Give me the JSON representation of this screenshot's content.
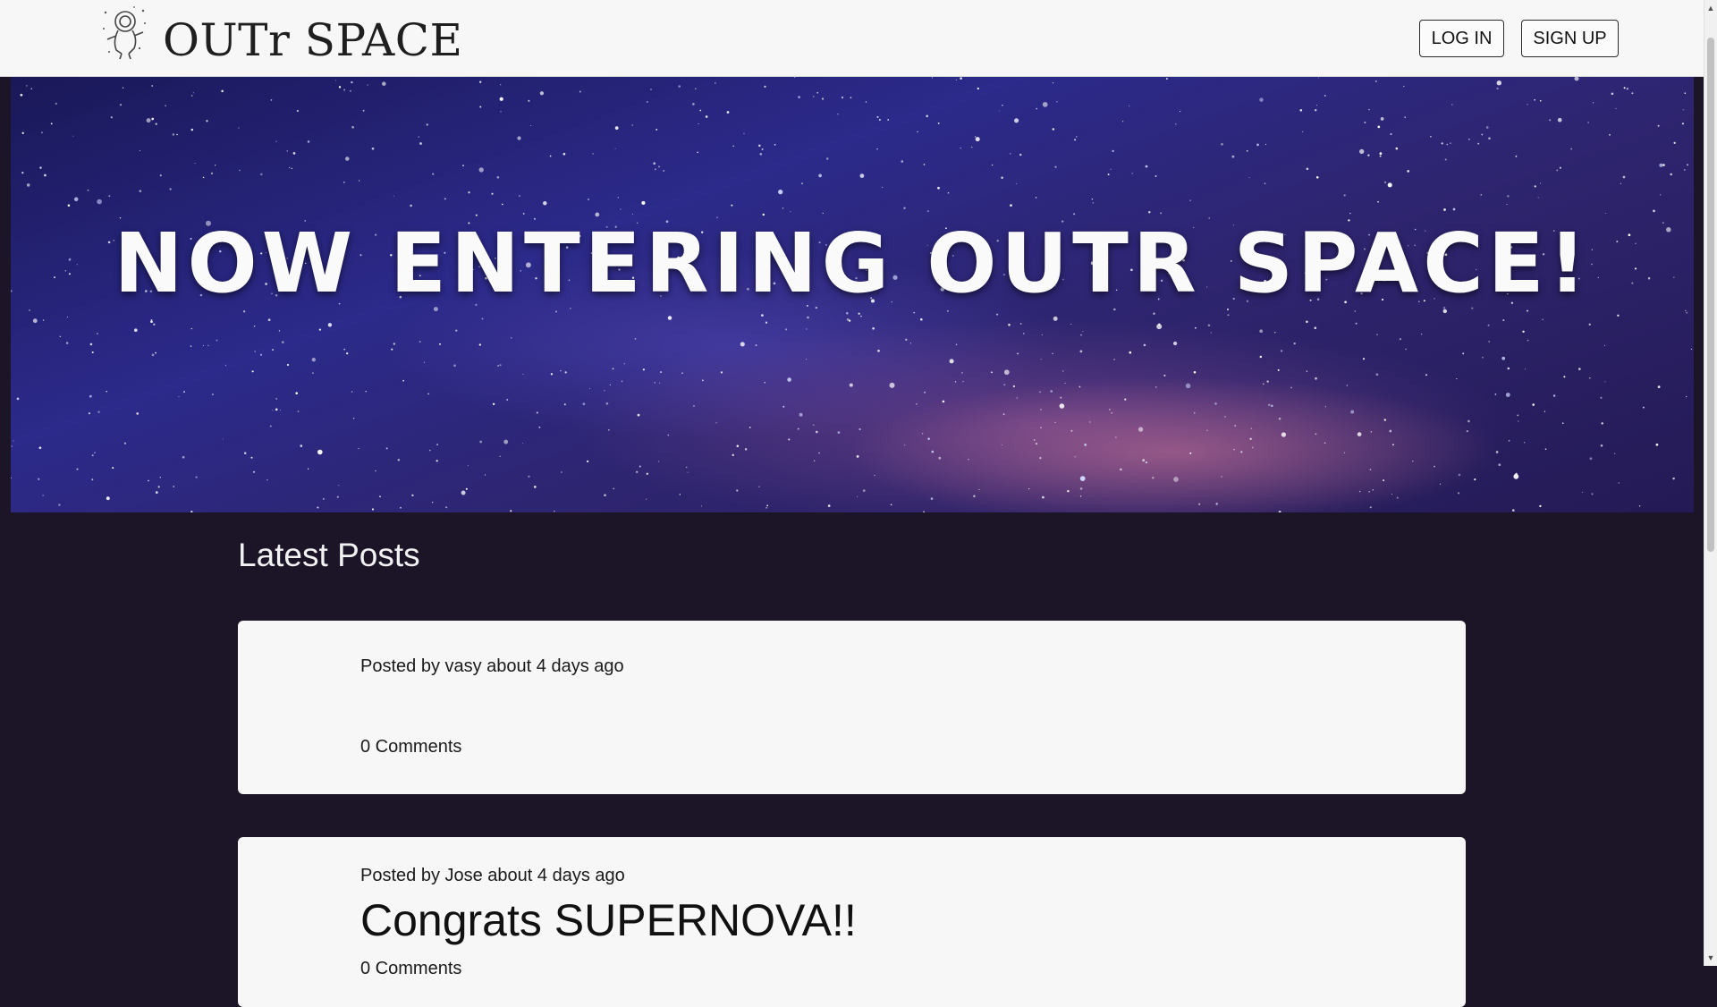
{
  "header": {
    "brand": "OUTr SPACE",
    "logo_icon": "astronaut-icon",
    "login_label": "LOG IN",
    "signup_label": "SIGN UP"
  },
  "hero": {
    "title": "NOW ENTERING OUTR SPACE!"
  },
  "main": {
    "section_title": "Latest Posts",
    "posts": [
      {
        "meta": "Posted by vasy about 4 days ago",
        "title": "",
        "comments": "0 Comments"
      },
      {
        "meta": "Posted by Jose about 4 days ago",
        "title": "Congrats SUPERNOVA!!",
        "comments": "0 Comments"
      }
    ]
  },
  "colors": {
    "page_background": "#1c1427",
    "header_background": "#f7f7f8",
    "card_background": "#f7f7f8"
  }
}
